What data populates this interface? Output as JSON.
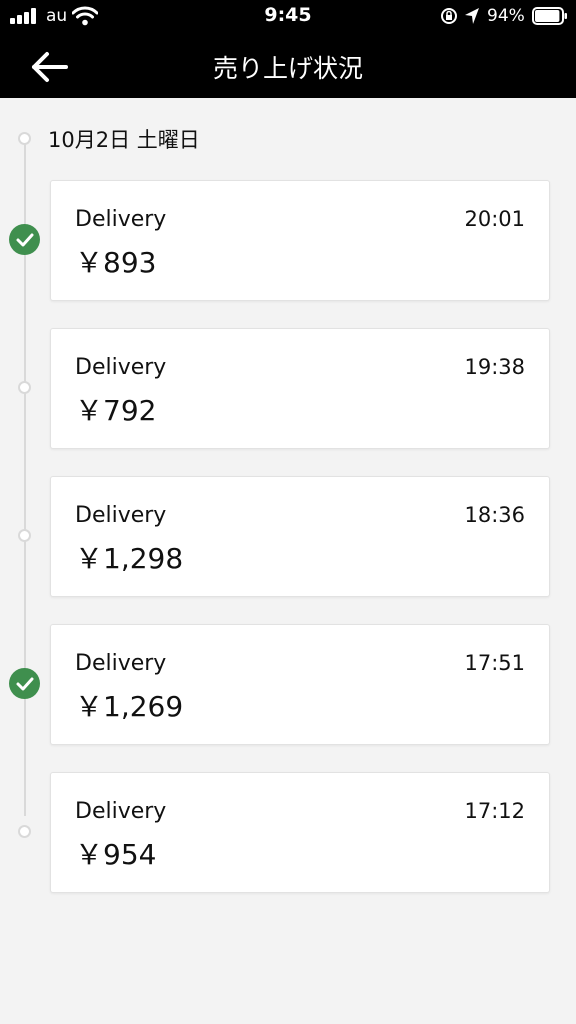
{
  "status_bar": {
    "carrier": "au",
    "time": "9:45",
    "battery": "94%",
    "battery_level": 0.94
  },
  "header": {
    "title": "売り上げ状況",
    "back_icon": "back-arrow-icon"
  },
  "date_label": "10月2日 土曜日",
  "trips": [
    {
      "label": "Delivery",
      "time": "20:01",
      "amount": "￥893",
      "completed": true
    },
    {
      "label": "Delivery",
      "time": "19:38",
      "amount": "￥792",
      "completed": false
    },
    {
      "label": "Delivery",
      "time": "18:36",
      "amount": "￥1,298",
      "completed": false
    },
    {
      "label": "Delivery",
      "time": "17:51",
      "amount": "￥1,269",
      "completed": true
    },
    {
      "label": "Delivery",
      "time": "17:12",
      "amount": "￥954",
      "completed": false
    }
  ],
  "colors": {
    "header_bg": "#000000",
    "check_green": "#3f8f4e",
    "page_bg": "#f3f3f3"
  }
}
